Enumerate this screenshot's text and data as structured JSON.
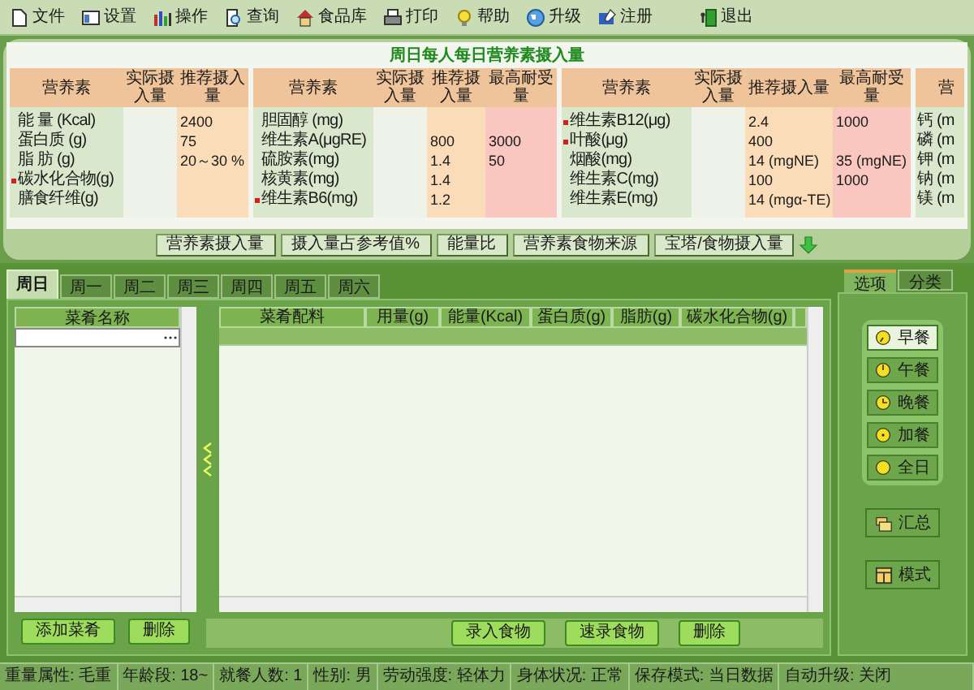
{
  "menu": [
    "文件",
    "设置",
    "操作",
    "查询",
    "食品库",
    "打印",
    "帮助",
    "升级",
    "注册",
    "退出"
  ],
  "intake_panel": {
    "title": "周日每人每日营养素摄入量",
    "groups": [
      {
        "headers": [
          "营养素",
          "实际摄入量",
          "推荐摄入量"
        ],
        "rows": [
          {
            "name": "能 量 (Kcal)",
            "marked": false,
            "recommended": "2400"
          },
          {
            "name": "蛋白质 (g)",
            "marked": false,
            "recommended": "75"
          },
          {
            "name": "脂 肪 (g)",
            "marked": false,
            "recommended": "20～30 %"
          },
          {
            "name": "碳水化合物(g)",
            "marked": true
          },
          {
            "name": "膳食纤维(g)",
            "marked": false
          }
        ]
      },
      {
        "headers": [
          "营养素",
          "实际摄入量",
          "推荐摄入量",
          "最高耐受量"
        ],
        "rows": [
          {
            "name": "胆固醇 (mg)",
            "marked": false
          },
          {
            "name": "维生素A(μgRE)",
            "marked": false,
            "recommended": "800",
            "max": "3000"
          },
          {
            "name": "硫胺素(mg)",
            "marked": false,
            "recommended": "1.4",
            "max": "50"
          },
          {
            "name": "核黄素(mg)",
            "marked": false,
            "recommended": "1.4"
          },
          {
            "name": "维生素B6(mg)",
            "marked": true,
            "recommended": "1.2"
          }
        ]
      },
      {
        "headers": [
          "营养素",
          "实际摄入量",
          "推荐摄入量",
          "最高耐受量"
        ],
        "rows": [
          {
            "name": "维生素B12(μg)",
            "marked": true,
            "recommended": "2.4",
            "max": "1000"
          },
          {
            "name": "叶酸(μg)",
            "marked": true,
            "recommended": "400"
          },
          {
            "name": "烟酸(mg)",
            "marked": false,
            "recommended": "14 (mgNE)",
            "max": "35 (mgNE)"
          },
          {
            "name": "维生素C(mg)",
            "marked": false,
            "recommended": "100",
            "max": "1000"
          },
          {
            "name": "维生素E(mg)",
            "marked": false,
            "recommended": "14 (mgα-TE)"
          }
        ]
      },
      {
        "headers": [
          "营"
        ],
        "rows": [
          {
            "name": "钙 (m",
            "marked": false
          },
          {
            "name": "磷 (m",
            "marked": false
          },
          {
            "name": "钾 (m",
            "marked": false
          },
          {
            "name": "钠 (m",
            "marked": false
          },
          {
            "name": "镁 (m",
            "marked": false
          }
        ]
      }
    ],
    "buttons": [
      "营养素摄入量",
      "摄入量占参考值%",
      "能量比",
      "营养素食物来源",
      "宝塔/食物摄入量"
    ]
  },
  "day_tabs": [
    {
      "label": "周日",
      "selected": true
    },
    {
      "label": "周一",
      "selected": false
    },
    {
      "label": "周二",
      "selected": false
    },
    {
      "label": "周三",
      "selected": false
    },
    {
      "label": "周四",
      "selected": false
    },
    {
      "label": "周五",
      "selected": false
    },
    {
      "label": "周六",
      "selected": false
    }
  ],
  "dish_list": {
    "header": "菜肴名称",
    "buttons": [
      "添加菜肴",
      "删除"
    ]
  },
  "ingredient_grid": {
    "columns": [
      "菜肴配料",
      "用量(g)",
      "能量(Kcal)",
      "蛋白质(g)",
      "脂肪(g)",
      "碳水化合物(g)"
    ],
    "buttons": [
      "录入食物",
      "速录食物",
      "删除"
    ]
  },
  "side_tabs": [
    {
      "label": "选项",
      "selected": true
    },
    {
      "label": "分类",
      "selected": false
    }
  ],
  "meals": [
    {
      "label": "早餐",
      "selected": true
    },
    {
      "label": "午餐",
      "selected": false
    },
    {
      "label": "晚餐",
      "selected": false
    },
    {
      "label": "加餐",
      "selected": false
    },
    {
      "label": "全日",
      "selected": false
    }
  ],
  "side_buttons": [
    "汇总",
    "模式"
  ],
  "status_bar": [
    "重量属性: 毛重",
    "年龄段: 18~",
    "就餐人数: 1",
    "性别: 男",
    "劳动强度: 轻体力",
    "身体状况: 正常",
    "保存模式: 当日数据",
    "自动升级: 关闭"
  ]
}
